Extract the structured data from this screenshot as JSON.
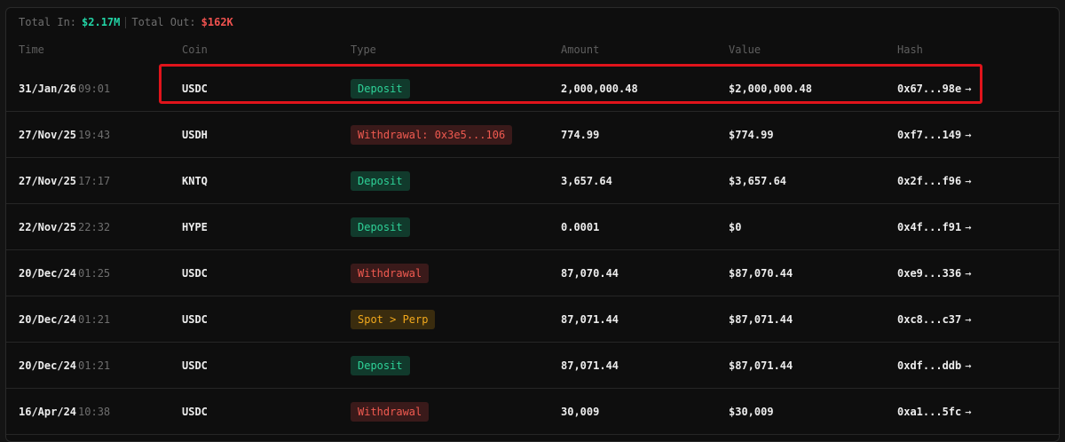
{
  "summary": {
    "in_label": "Total In:",
    "in_value": "$2.17M",
    "out_label": "Total Out:",
    "out_value": "$162K"
  },
  "columns": {
    "time": "Time",
    "coin": "Coin",
    "type": "Type",
    "amount": "Amount",
    "value": "Value",
    "hash": "Hash"
  },
  "rows": [
    {
      "date": "31/Jan/26",
      "clock": "09:01",
      "coin": "USDC",
      "type": "Deposit",
      "amount": "2,000,000.48",
      "value": "$2,000,000.48",
      "hash": "0x67...98e"
    },
    {
      "date": "27/Nov/25",
      "clock": "19:43",
      "coin": "USDH",
      "type": "Withdrawal: 0x3e5...106",
      "amount": "774.99",
      "value": "$774.99",
      "hash": "0xf7...149"
    },
    {
      "date": "27/Nov/25",
      "clock": "17:17",
      "coin": "KNTQ",
      "type": "Deposit",
      "amount": "3,657.64",
      "value": "$3,657.64",
      "hash": "0x2f...f96"
    },
    {
      "date": "22/Nov/25",
      "clock": "22:32",
      "coin": "HYPE",
      "type": "Deposit",
      "amount": "0.0001",
      "value": "$0",
      "hash": "0x4f...f91"
    },
    {
      "date": "20/Dec/24",
      "clock": "01:25",
      "coin": "USDC",
      "type": "Withdrawal",
      "amount": "87,070.44",
      "value": "$87,070.44",
      "hash": "0xe9...336"
    },
    {
      "date": "20/Dec/24",
      "clock": "01:21",
      "coin": "USDC",
      "type": "Spot > Perp",
      "amount": "87,071.44",
      "value": "$87,071.44",
      "hash": "0xc8...c37"
    },
    {
      "date": "20/Dec/24",
      "clock": "01:21",
      "coin": "USDC",
      "type": "Deposit",
      "amount": "87,071.44",
      "value": "$87,071.44",
      "hash": "0xdf...ddb"
    },
    {
      "date": "16/Apr/24",
      "clock": "10:38",
      "coin": "USDC",
      "type": "Withdrawal",
      "amount": "30,009",
      "value": "$30,009",
      "hash": "0xa1...5fc"
    }
  ],
  "icons": {
    "hash_link": "arrow-right-icon"
  },
  "colors": {
    "total_in": "#22d3a5",
    "total_out": "#f0524f",
    "deposit": "#2ed197",
    "withdrawal": "#f05a50",
    "transfer": "#f2a91d",
    "highlight": "#e0141b"
  }
}
